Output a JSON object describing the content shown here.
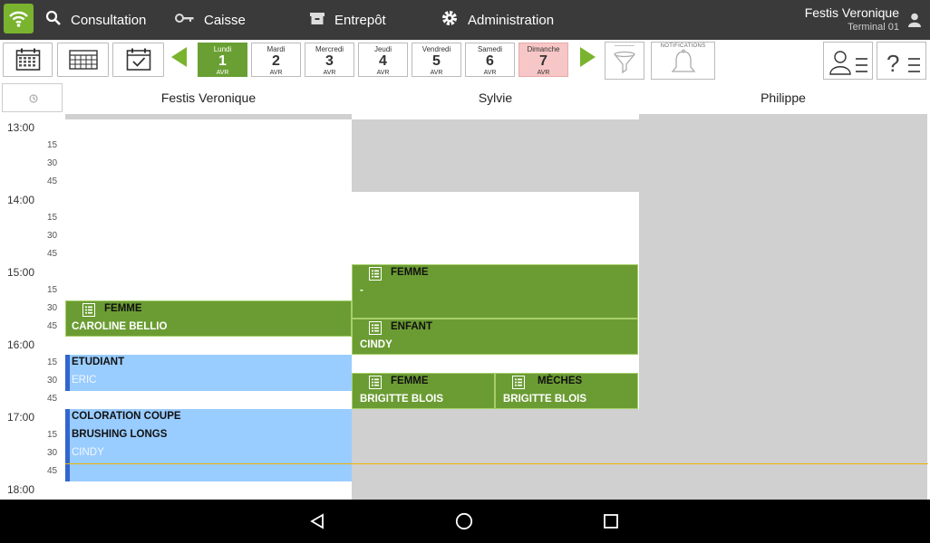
{
  "topbar": {
    "nav": [
      {
        "label": "Consultation",
        "icon": "search-icon"
      },
      {
        "label": "Caisse",
        "icon": "key-icon"
      },
      {
        "label": "Entrepôt",
        "icon": "box-icon"
      },
      {
        "label": "Administration",
        "icon": "gear-icon"
      }
    ],
    "user_name": "Festis Veronique",
    "terminal": "Terminal 01"
  },
  "toolbar": {
    "days": [
      {
        "name": "Lundi",
        "num": "1",
        "month": "AVR",
        "state": "active"
      },
      {
        "name": "Mardi",
        "num": "2",
        "month": "AVR",
        "state": "normal"
      },
      {
        "name": "Mercredi",
        "num": "3",
        "month": "AVR",
        "state": "normal"
      },
      {
        "name": "Jeudi",
        "num": "4",
        "month": "AVR",
        "state": "normal"
      },
      {
        "name": "Vendredi",
        "num": "5",
        "month": "AVR",
        "state": "normal"
      },
      {
        "name": "Samedi",
        "num": "6",
        "month": "AVR",
        "state": "normal"
      },
      {
        "name": "Dimanche",
        "num": "7",
        "month": "AVR",
        "state": "sunday"
      }
    ],
    "notifications_label": "NOTIFICATIONS"
  },
  "columns": [
    "Festis Veronique",
    "Sylvie",
    "Philippe"
  ],
  "time_slots": [
    {
      "hour": "13:00",
      "subs": [
        "15",
        "30",
        "45"
      ]
    },
    {
      "hour": "14:00",
      "subs": [
        "15",
        "30",
        "45"
      ]
    },
    {
      "hour": "15:00",
      "subs": [
        "15",
        "30",
        "45"
      ]
    },
    {
      "hour": "16:00",
      "subs": [
        "15",
        "30",
        "45"
      ]
    },
    {
      "hour": "17:00",
      "subs": [
        "15",
        "30",
        "45"
      ]
    },
    {
      "hour": "18:00",
      "subs": []
    }
  ],
  "appointments": {
    "veronique_1": {
      "service": "FEMME",
      "client": "CAROLINE BELLIO"
    },
    "veronique_2": {
      "service": "ETUDIANT",
      "client": "ERIC"
    },
    "veronique_3": {
      "service": "COLORATION COUPE",
      "service2": "BRUSHING LONGS",
      "client": "CINDY"
    },
    "sylvie_1": {
      "service": "FEMME",
      "client": "-"
    },
    "sylvie_2": {
      "service": "ENFANT",
      "client": "CINDY"
    },
    "sylvie_3": {
      "service": "FEMME",
      "client": "BRIGITTE BLOIS"
    },
    "sylvie_4": {
      "service": "MÈCHES",
      "client": "BRIGITTE BLOIS"
    }
  },
  "colors": {
    "accent_green": "#7ab32e",
    "appt_green": "#6b9c33",
    "appt_blue": "#99ccff",
    "appt_blue_border": "#3366cc",
    "unavailable_gray": "#d0d0d0",
    "now_line": "#f0b400",
    "sunday": "#f7c6c6"
  }
}
